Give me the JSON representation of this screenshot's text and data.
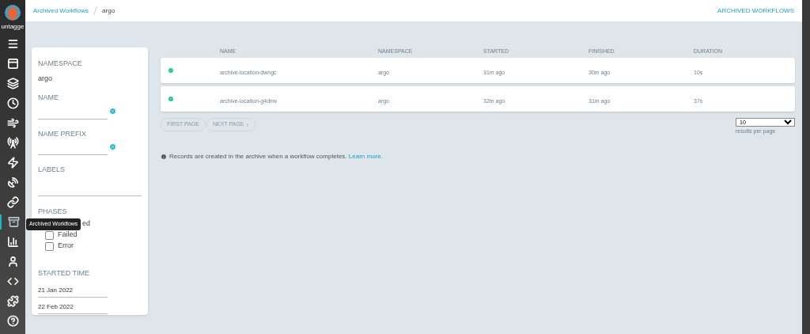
{
  "nav": {
    "user": "untagge",
    "items": [
      {
        "selected": false
      },
      {
        "selected": false
      },
      {
        "selected": false
      },
      {
        "selected": false
      },
      {
        "selected": false
      },
      {
        "selected": false
      },
      {
        "selected": false
      },
      {
        "selected": false
      },
      {
        "selected": false
      },
      {
        "selected": true
      },
      {
        "selected": false
      },
      {
        "selected": false
      },
      {
        "selected": false
      },
      {
        "selected": false
      },
      {
        "selected": false
      }
    ],
    "tooltip": "Archived Workflows"
  },
  "breadcrumbs": [
    {
      "label": "Archived Workflows",
      "kind": "link"
    },
    {
      "label": "argo",
      "kind": "current"
    }
  ],
  "page_title": "ARCHIVED WORKFLOWS",
  "filters": {
    "namespace": {
      "label": "NAMESPACE",
      "value": "argo"
    },
    "name": {
      "label": "NAME"
    },
    "name_prefix": {
      "label": "NAME PREFIX"
    },
    "labels": {
      "label": "LABELS"
    },
    "phases": {
      "label": "PHASES",
      "items": [
        {
          "label": "ed",
          "kind": "partial"
        },
        {
          "label": "Failed",
          "checked": false,
          "kind": "checkbox"
        },
        {
          "label": "Error",
          "checked": false,
          "kind": "checkbox"
        }
      ]
    },
    "started_time": {
      "label": "STARTED TIME",
      "from": "21 Jan 2022",
      "to": "22 Feb 2022"
    }
  },
  "table": {
    "columns": [
      "NAME",
      "NAMESPACE",
      "STARTED",
      "FINISHED",
      "DURATION"
    ],
    "rows": [
      {
        "name": "archive-location-dwngc",
        "namespace": "argo",
        "started": "31m ago",
        "finished": "30m ago",
        "duration": "10s"
      },
      {
        "name": "archive-location-g4dmv",
        "namespace": "argo",
        "started": "32m ago",
        "finished": "31m ago",
        "duration": "37s"
      }
    ]
  },
  "pagination": {
    "buttons": [
      "FIRST PAGE",
      "NEXT PAGE"
    ],
    "page_size": "10",
    "page_size_label": "results per page"
  },
  "info": {
    "text": "Records are created in the archive when a workflow completes.",
    "link": "Learn more."
  }
}
